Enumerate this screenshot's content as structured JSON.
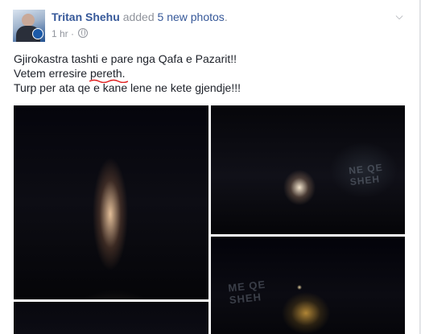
{
  "post": {
    "author": "Tritan Shehu",
    "verb": "added",
    "count_link": "5 new photos",
    "period": ".",
    "time": "1 hr",
    "separator": "·",
    "lines": [
      "Gjirokastra tashti e pare nga Qafa e Pazarit!!",
      "Turp per ata qe e kane lene ne kete gjendje!!!"
    ],
    "line2_before": "Vetem erresire ",
    "line2_misspelled": "pereth",
    "line2_after": ".",
    "menu_icon": "chevron-down-icon",
    "privacy_icon": "globe-icon"
  },
  "photos": [
    {
      "name": "photo-1",
      "overlay": ""
    },
    {
      "name": "photo-2",
      "overlay": "NE QE\nSHEH"
    },
    {
      "name": "photo-3",
      "overlay": "ME QE\nSHEH"
    },
    {
      "name": "photo-4",
      "overlay": ""
    }
  ],
  "colors": {
    "link": "#365899",
    "meta": "#90949c",
    "text": "#1d2129",
    "spellcheck": "#e02020"
  }
}
